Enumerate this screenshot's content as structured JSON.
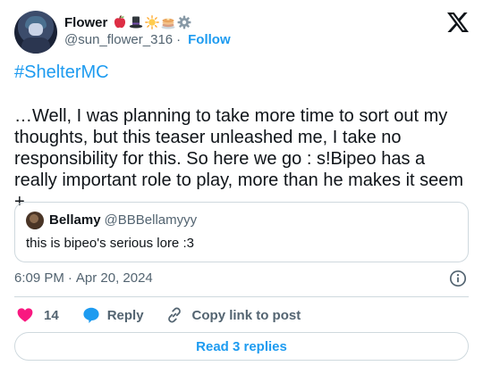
{
  "author": {
    "display_name": "Flower",
    "name_emoji_icons": [
      "apple-icon",
      "top-hat-icon",
      "sun-icon",
      "pancakes-icon",
      "gear-icon"
    ],
    "handle": "@sun_flower_316",
    "separator": "·",
    "follow_label": "Follow"
  },
  "tweet": {
    "hashtag": "#ShelterMC",
    "text": "…Well, I was planning to take more time to sort out my thoughts, but this teaser unleashed me, I take no responsibility for this. So here we go : s!Bipeo has a really important role to play, more than he makes it seem +"
  },
  "quote": {
    "display_name": "Bellamy",
    "handle": "@BBBellamyyy",
    "text": "this is bipeo's serious lore :3"
  },
  "timestamp": {
    "time": "6:09 PM",
    "separator": "·",
    "date": "Apr 20, 2024"
  },
  "actions": {
    "like_count": "14",
    "reply_label": "Reply",
    "copy_link_label": "Copy link to post"
  },
  "footer": {
    "read_replies_label": "Read 3 replies"
  },
  "colors": {
    "accent": "#1d9bf0",
    "like": "#f91880",
    "text_primary": "#0f1419",
    "text_secondary": "#536471",
    "border": "#cfd9de"
  }
}
